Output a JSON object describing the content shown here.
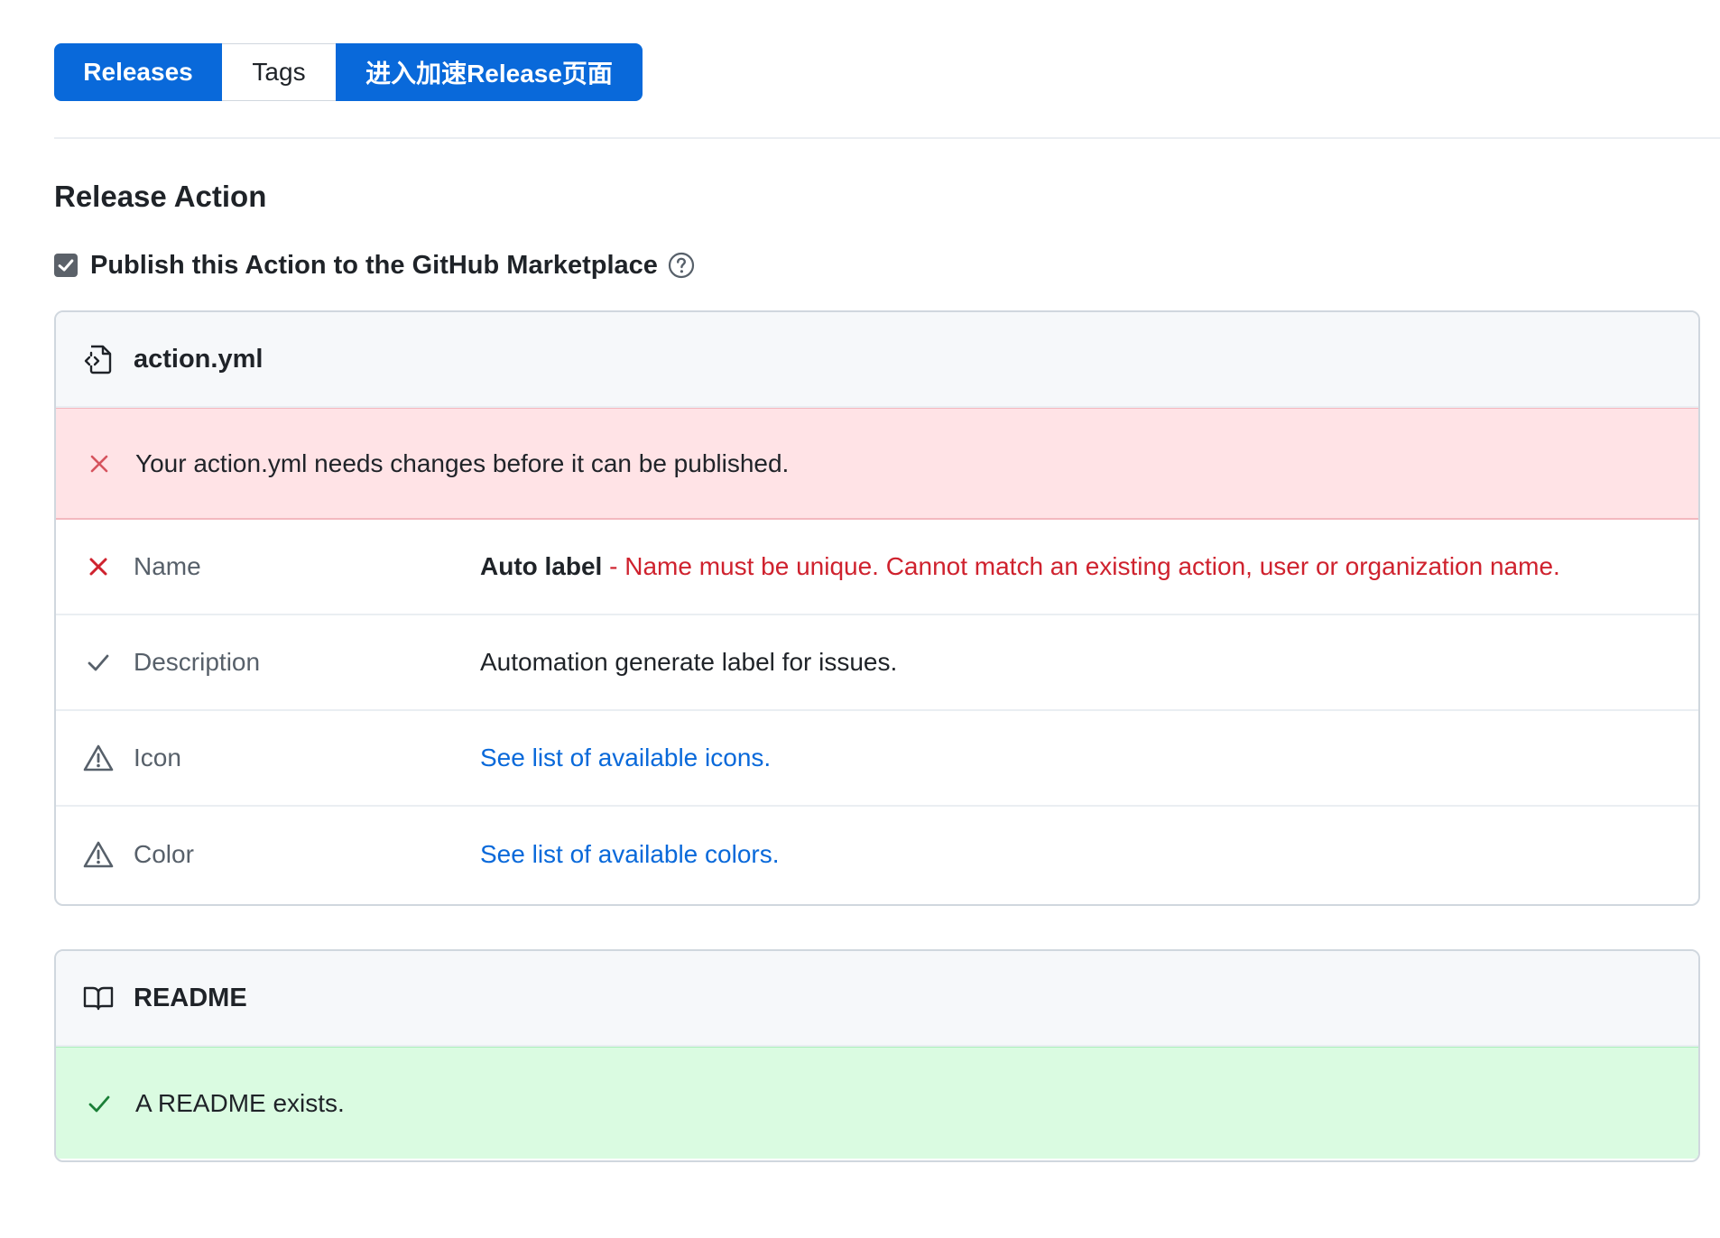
{
  "tabs": {
    "releases": "Releases",
    "tags": "Tags",
    "accelerate": "进入加速Release页面"
  },
  "section": {
    "title": "Release Action"
  },
  "publish": {
    "checked": true,
    "label": "Publish this Action to the GitHub Marketplace",
    "help_icon": "question-circle-icon"
  },
  "action_box": {
    "icon": "file-code-icon",
    "title": "action.yml",
    "flash_icon": "x-icon",
    "flash_text": "Your action.yml needs changes before it can be published.",
    "rows": [
      {
        "status": "error",
        "icon": "x-icon",
        "label": "Name",
        "value_strong": "Auto label",
        "value_error": " - Name must be unique. Cannot match an existing action, user or organization name."
      },
      {
        "status": "ok",
        "icon": "check-icon",
        "label": "Description",
        "value": "Automation generate label for issues."
      },
      {
        "status": "warning",
        "icon": "alert-icon",
        "label": "Icon",
        "link": "See list of available icons."
      },
      {
        "status": "warning",
        "icon": "alert-icon",
        "label": "Color",
        "link": "See list of available colors."
      }
    ]
  },
  "readme_box": {
    "icon": "book-icon",
    "title": "README",
    "flash_icon": "check-icon",
    "flash_text": "A README exists."
  },
  "colors": {
    "primary_blue": "#0969da",
    "error_red": "#cf222e",
    "success_green": "#1a7f37",
    "error_bg": "#ffe3e6",
    "success_bg": "#dafbe1",
    "header_bg": "#f6f8fa",
    "border": "#d0d7de"
  }
}
